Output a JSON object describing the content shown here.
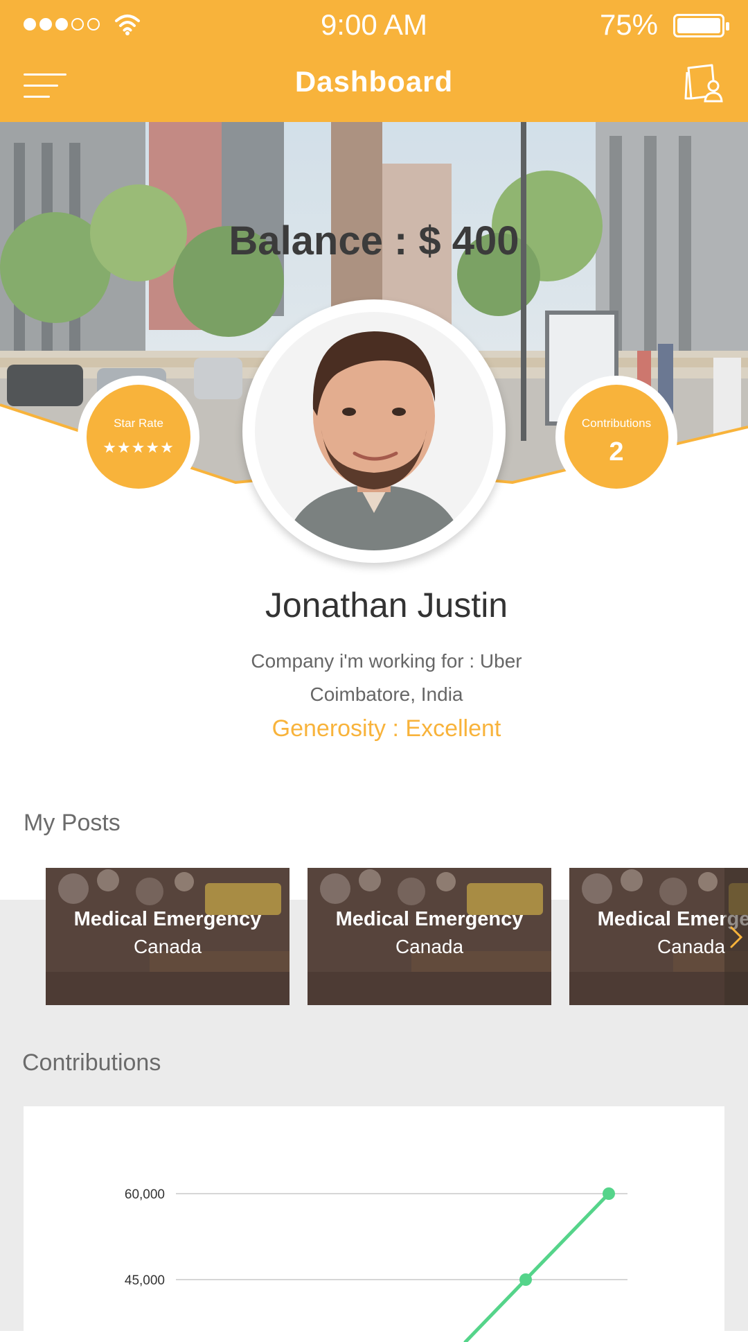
{
  "status_bar": {
    "time": "9:00 AM",
    "battery": "75%",
    "battery_level": 0.75,
    "signal_bars": 3,
    "signal_max": 5
  },
  "nav": {
    "title": "Dashboard",
    "menu_icon": "hamburger-menu-icon",
    "profile_icon": "profile-card-icon"
  },
  "hero": {
    "balance": "Balance : $ 400"
  },
  "badges": {
    "star_rate": {
      "label": "Star Rate",
      "stars": "★★★★★",
      "rating": 5
    },
    "contributions": {
      "label": "Contributions",
      "value": "2"
    }
  },
  "profile": {
    "name": "Jonathan Justin",
    "company": "Company i'm working for : Uber",
    "location": "Coimbatore, India",
    "generosity": "Generosity : Excellent"
  },
  "posts": {
    "title": "My Posts",
    "items": [
      {
        "title": "Medical Emergency",
        "subtitle": "Canada"
      },
      {
        "title": "Medical Emergency",
        "subtitle": "Canada"
      },
      {
        "title": "Medical Emergency",
        "subtitle": "Canada"
      }
    ],
    "next_icon": "chevron-right-icon"
  },
  "contributions_section": {
    "title": "Contributions"
  },
  "colors": {
    "accent": "#f8b33b",
    "chart_line": "#55d48a",
    "text_dark": "#333333",
    "text_muted": "#666666",
    "background_gray": "#ebebeb"
  },
  "chart_data": {
    "type": "line",
    "title": "",
    "xlabel": "",
    "ylabel": "",
    "y_ticks": [
      {
        "value": 60000,
        "label": "60,000"
      },
      {
        "value": 45000,
        "label": "45,000"
      }
    ],
    "series": [
      {
        "points": [
          {
            "index": 1,
            "y": 45000
          },
          {
            "index": 2,
            "y": 60000
          }
        ]
      }
    ],
    "grid": true
  }
}
